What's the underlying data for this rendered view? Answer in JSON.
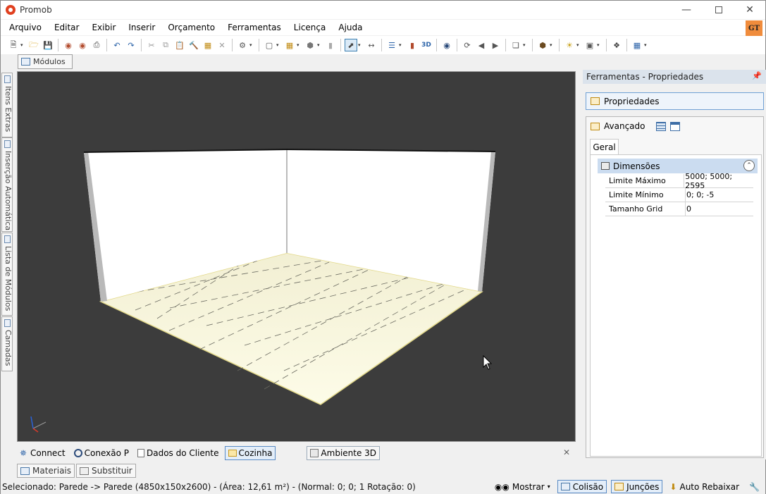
{
  "window": {
    "title": "Promob"
  },
  "menu": [
    "Arquivo",
    "Editar",
    "Exibir",
    "Inserir",
    "Orçamento",
    "Ferramentas",
    "Licença",
    "Ajuda"
  ],
  "badge": "GT",
  "modules_tab": "Módulos",
  "side_tabs": [
    "Itens Extras",
    "Inserção Automática",
    "Lista de Módulos",
    "Camadas"
  ],
  "doc_tabs": [
    {
      "label": "Connect",
      "icon": "rss-icon"
    },
    {
      "label": "Conexão P",
      "icon": "connection-icon"
    },
    {
      "label": "Dados do Cliente",
      "icon": "document-icon"
    },
    {
      "label": "Cozinha",
      "icon": "folder-icon"
    },
    {
      "label": "Ambiente 3D",
      "icon": "environment-icon"
    }
  ],
  "bottom_tabs": [
    "Materiais",
    "Substituir"
  ],
  "right_panel": {
    "title": "Ferramentas - Propriedades",
    "properties_button": "Propriedades",
    "advanced": "Avançado",
    "tab": "Geral",
    "group": "Dimensões",
    "rows": [
      {
        "key": "Limite Máximo",
        "value": "5000; 5000; 2595"
      },
      {
        "key": "Limite Mínimo",
        "value": "0; 0; -5"
      },
      {
        "key": "Tamanho Grid",
        "value": "0"
      }
    ]
  },
  "status": {
    "text": "Selecionado: Parede -> Parede (4850x150x2600) - (Área: 12,61 m²) - (Normal: 0; 0; 1 Rotação: 0)",
    "mostrar": "Mostrar",
    "colisao": "Colisão",
    "juncoes": "Junções",
    "auto_rebaixar": "Auto Rebaixar"
  },
  "colors": {
    "accent": "#3c7fb1",
    "viewport_bg": "#3c3c3c",
    "floor": "#fdfbe0"
  }
}
